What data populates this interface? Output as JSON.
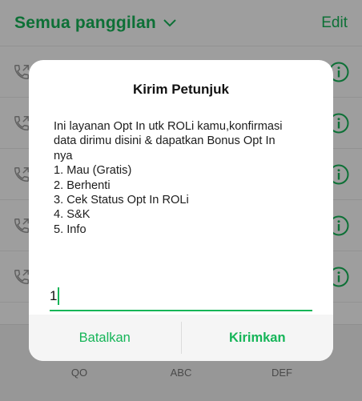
{
  "colors": {
    "accent": "#15b558"
  },
  "header": {
    "filter_label": "Semua panggilan",
    "filter_icon": "chevron-down-icon",
    "edit_label": "Edit"
  },
  "call_rows": [
    {
      "icon": "outgoing-call-icon",
      "action_icon": "info-icon"
    },
    {
      "icon": "outgoing-call-icon",
      "action_icon": "info-icon"
    },
    {
      "icon": "outgoing-call-icon",
      "action_icon": "info-icon"
    },
    {
      "icon": "outgoing-call-icon",
      "action_icon": "info-icon"
    },
    {
      "icon": "outgoing-call-icon",
      "action_icon": "info-icon"
    }
  ],
  "keypad": {
    "letters": [
      "QO",
      "ABC",
      "DEF"
    ]
  },
  "dialog": {
    "title": "Kirim Petunjuk",
    "message_lines": [
      "Ini layanan Opt In utk ROLi kamu,konfirmasi",
      "data dirimu disini & dapatkan Bonus Opt In",
      "nya",
      "1. Mau (Gratis)",
      "2. Berhenti",
      "3. Cek Status Opt In ROLi",
      "4. S&K",
      "5. Info"
    ],
    "input_value": "1",
    "cancel_label": "Batalkan",
    "send_label": "Kirimkan"
  }
}
